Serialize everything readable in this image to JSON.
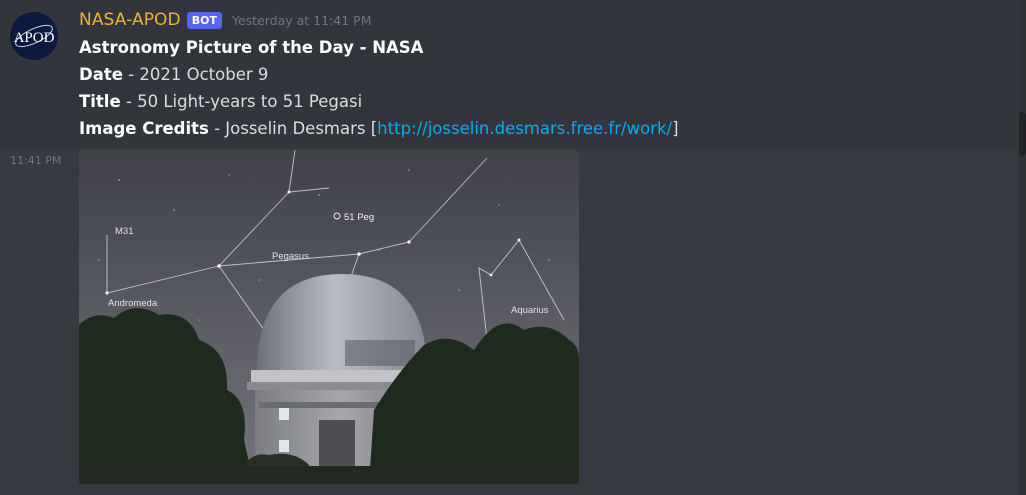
{
  "message": {
    "username": "NASA-APOD",
    "bot_tag": "BOT",
    "timestamp": "Yesterday at 11:41 PM",
    "avatar_text": "APOD",
    "title": "Astronomy Picture of the Day - NASA",
    "date_label": "Date",
    "date_sep": " - ",
    "date_value": "2021 October 9",
    "title_label": "Title",
    "title_sep": " - ",
    "title_value": "50 Light-years to 51 Pegasi",
    "credits_label": "Image Credits",
    "credits_sep": " - ",
    "credits_value": "Josselin Desmars",
    "credits_open": " [",
    "credits_url": "http://josselin.desmars.free.fr/work/",
    "credits_close": "]"
  },
  "attachment": {
    "side_time": "11:41 PM",
    "labels": {
      "m31": "M31",
      "andromeda": "Andromeda",
      "pegasus": "Pegasus",
      "peg51": "51 Peg",
      "aquarius": "Aquarius"
    }
  },
  "colors": {
    "background": "#36393f",
    "username": "#f0b232",
    "bot_tag": "#5865f2",
    "link": "#00aff4"
  },
  "icons": {
    "avatar": "apod-logo-icon"
  }
}
